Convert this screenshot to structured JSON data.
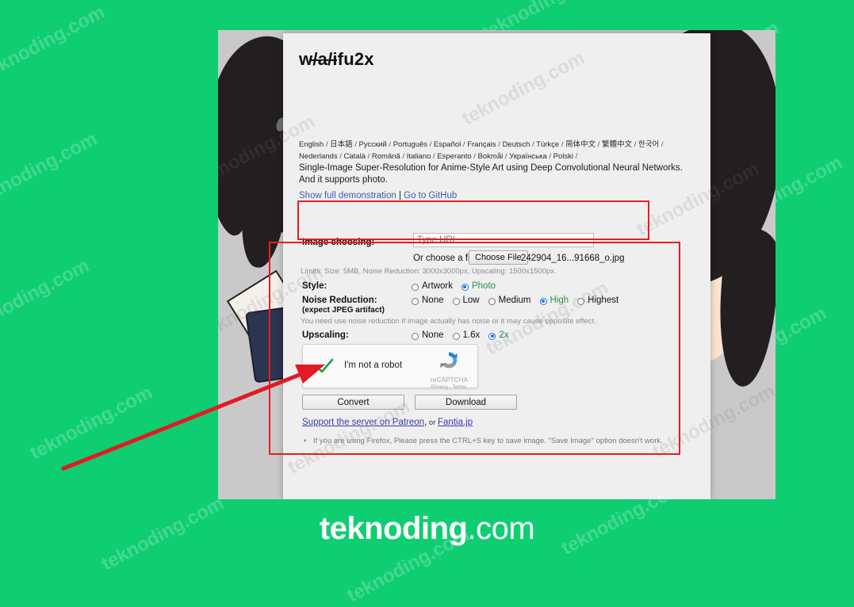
{
  "site": {
    "title": "w/a/ifu2x",
    "watermark_text": "teknoding.com",
    "brand_bold": "teknoding",
    "brand_light": ".com"
  },
  "languages": {
    "separator": "/",
    "items": [
      "English",
      "日本語",
      "Русский",
      "Português",
      "Español",
      "Français",
      "Deutsch",
      "Türkçe",
      "简体中文",
      "繁體中文",
      "한국어",
      "Nederlands",
      "Català",
      "Română",
      "Italiano",
      "Esperanto",
      "Bokmål",
      "Українська",
      "Polski"
    ]
  },
  "description": "Single-Image Super-Resolution for Anime-Style Art using Deep Convolutional Neural Networks. And it supports photo.",
  "links": {
    "show_demo": "Show full demonstration",
    "divider": "|",
    "github": "Go to GitHub"
  },
  "image_choosing": {
    "label": "Image choosing:",
    "url_placeholder": "Type URL",
    "url_value": "",
    "or_choose_label": "Or choose a file:",
    "choose_file_button": "Choose File",
    "file_name": "242904_16...91668_o.jpg",
    "limits": "Limits: Size: 5MB, Noise Reduction: 3000x3000px, Upscaling: 1500x1500px."
  },
  "options": {
    "style": {
      "label": "Style:",
      "choices": [
        "Artwork",
        "Photo"
      ],
      "selected": "Photo"
    },
    "noise_reduction": {
      "label": "Noise Reduction:",
      "sublabel": "(expect JPEG artifact)",
      "choices": [
        "None",
        "Low",
        "Medium",
        "High",
        "Highest"
      ],
      "selected": "High",
      "note": "You need use noise reduction if image actually has noise or it may cause opposite effect."
    },
    "upscaling": {
      "label": "Upscaling:",
      "choices": [
        "None",
        "1.6x",
        "2x"
      ],
      "selected": "2x"
    }
  },
  "recaptcha": {
    "checkbox_label": "I'm not a robot",
    "checked": true,
    "brand": "reCAPTCHA",
    "privacy": "Privacy",
    "dot": "·",
    "terms": "Terms"
  },
  "buttons": {
    "convert": "Convert",
    "download": "Download"
  },
  "support": {
    "patreon": "Support the server on Patreon",
    "comma": ",",
    "or": " or ",
    "fantia": "Fantia.jp"
  },
  "notes": {
    "bullet": "•",
    "firefox": "If you are using Firefox, Please press the CTRL+S key to save image. \"Save Image\" option doesn't work."
  },
  "colors": {
    "page_background": "#0fce72",
    "annotation_red": "#ea1c24",
    "selected_label_green": "#2f8f4e",
    "radio_blue": "#1a73e8",
    "link_blue": "#3a5fa8",
    "patreon_link": "#3a3ab0",
    "card_background": "#efefef"
  }
}
